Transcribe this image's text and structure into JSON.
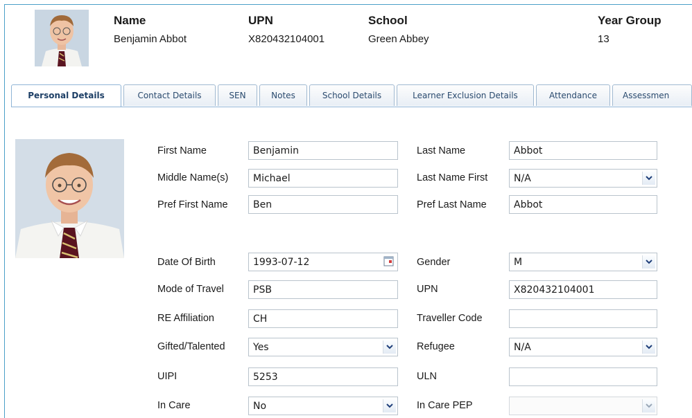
{
  "header": {
    "name_label": "Name",
    "name_value": "Benjamin Abbot",
    "upn_label": "UPN",
    "upn_value": "X820432104001",
    "school_label": "School",
    "school_value": "Green Abbey",
    "year_label": "Year Group",
    "year_value": "13"
  },
  "tabs": [
    "Personal Details",
    "Contact Details",
    "SEN",
    "Notes",
    "School Details",
    "Learner Exclusion Details",
    "Attendance",
    "Assessmen"
  ],
  "form": {
    "first_name": {
      "label": "First Name",
      "value": "Benjamin"
    },
    "middle_names": {
      "label": "Middle Name(s)",
      "value": "Michael"
    },
    "pref_first_name": {
      "label": "Pref First Name",
      "value": "Ben"
    },
    "last_name": {
      "label": "Last Name",
      "value": "Abbot"
    },
    "last_name_first": {
      "label": "Last Name First",
      "value": "N/A"
    },
    "pref_last_name": {
      "label": "Pref Last Name",
      "value": "Abbot"
    },
    "dob": {
      "label": "Date Of Birth",
      "value": "1993-07-12"
    },
    "mode_of_travel": {
      "label": "Mode of Travel",
      "value": "PSB"
    },
    "re_affiliation": {
      "label": "RE Affiliation",
      "value": "CH"
    },
    "gifted": {
      "label": "Gifted/Talented",
      "value": "Yes"
    },
    "uipi": {
      "label": "UIPI",
      "value": "5253"
    },
    "in_care": {
      "label": "In Care",
      "value": "No"
    },
    "gender": {
      "label": "Gender",
      "value": "M"
    },
    "upn": {
      "label": "UPN",
      "value": "X820432104001"
    },
    "traveller_code": {
      "label": "Traveller Code",
      "value": ""
    },
    "refugee": {
      "label": "Refugee",
      "value": "N/A"
    },
    "uln": {
      "label": "ULN",
      "value": ""
    },
    "in_care_pep": {
      "label": "In Care PEP",
      "value": ""
    }
  },
  "colors": {
    "accent": "#4a9fc8",
    "tab_text": "#2a4a6e",
    "dropdown_arrow": "#1f3f7a"
  }
}
